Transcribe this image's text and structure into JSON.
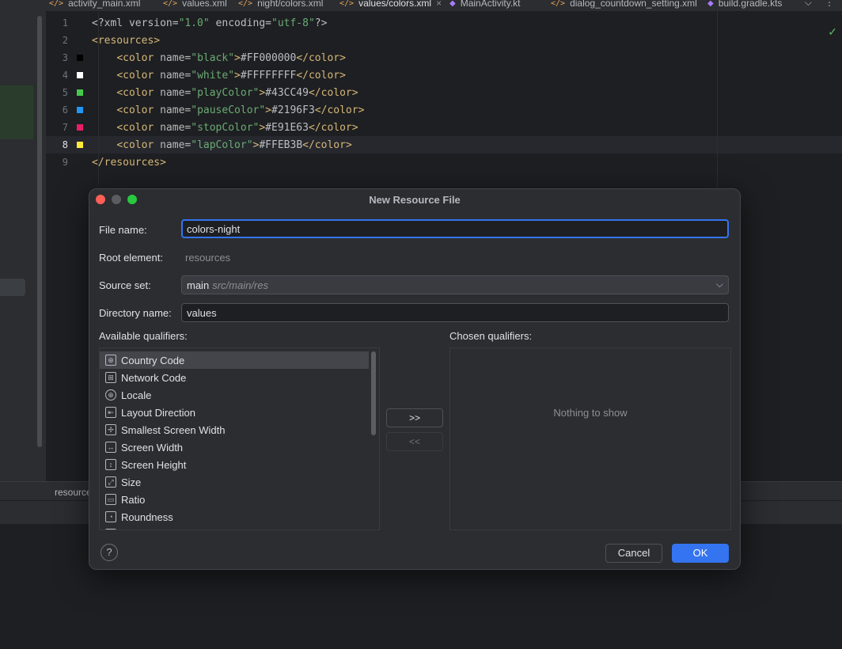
{
  "tabs": [
    {
      "label": "activity_main.xml",
      "icon": "xml-icon"
    },
    {
      "label": "values.xml",
      "icon": "xml-icon"
    },
    {
      "label": "night/colors.xml",
      "icon": "xml-icon"
    },
    {
      "label": "values/colors.xml",
      "icon": "xml-icon",
      "close": "×"
    },
    {
      "label": "MainActivity.kt",
      "icon": "kotlin-icon"
    },
    {
      "label": "dialog_countdown_setting.xml",
      "icon": "xml-icon"
    },
    {
      "label": "build.gradle.kts",
      "icon": "gradle-icon"
    }
  ],
  "tab_overflow": "⌵",
  "tab_more": "⋮",
  "editor": {
    "lines": [
      {
        "num": "1",
        "swatch": "",
        "parts": [
          {
            "t": "text",
            "v": "<?xml version="
          },
          {
            "t": "str",
            "v": "\"1.0\""
          },
          {
            "t": "text",
            "v": " encoding="
          },
          {
            "t": "str",
            "v": "\"utf-8\""
          },
          {
            "t": "text",
            "v": "?>"
          }
        ]
      },
      {
        "num": "2",
        "swatch": "",
        "parts": [
          {
            "t": "tag",
            "v": "<resources>"
          }
        ]
      },
      {
        "num": "3",
        "swatch": "#000000",
        "parts": [
          {
            "t": "text",
            "v": "    "
          },
          {
            "t": "tag",
            "v": "<color "
          },
          {
            "t": "attr",
            "v": "name="
          },
          {
            "t": "str",
            "v": "\"black\""
          },
          {
            "t": "tag",
            "v": ">"
          },
          {
            "t": "text",
            "v": "#FF000000"
          },
          {
            "t": "tag",
            "v": "</color>"
          }
        ]
      },
      {
        "num": "4",
        "swatch": "#FFFFFF",
        "parts": [
          {
            "t": "text",
            "v": "    "
          },
          {
            "t": "tag",
            "v": "<color "
          },
          {
            "t": "attr",
            "v": "name="
          },
          {
            "t": "str",
            "v": "\"white\""
          },
          {
            "t": "tag",
            "v": ">"
          },
          {
            "t": "text",
            "v": "#FFFFFFFF"
          },
          {
            "t": "tag",
            "v": "</color>"
          }
        ]
      },
      {
        "num": "5",
        "swatch": "#43CC49",
        "parts": [
          {
            "t": "text",
            "v": "    "
          },
          {
            "t": "tag",
            "v": "<color "
          },
          {
            "t": "attr",
            "v": "name="
          },
          {
            "t": "str",
            "v": "\"playColor\""
          },
          {
            "t": "tag",
            "v": ">"
          },
          {
            "t": "text",
            "v": "#43CC49"
          },
          {
            "t": "tag",
            "v": "</color>"
          }
        ]
      },
      {
        "num": "6",
        "swatch": "#2196F3",
        "parts": [
          {
            "t": "text",
            "v": "    "
          },
          {
            "t": "tag",
            "v": "<color "
          },
          {
            "t": "attr",
            "v": "name="
          },
          {
            "t": "str",
            "v": "\"pauseColor\""
          },
          {
            "t": "tag",
            "v": ">"
          },
          {
            "t": "text",
            "v": "#2196F3"
          },
          {
            "t": "tag",
            "v": "</color>"
          }
        ]
      },
      {
        "num": "7",
        "swatch": "#E91E63",
        "parts": [
          {
            "t": "text",
            "v": "    "
          },
          {
            "t": "tag",
            "v": "<color "
          },
          {
            "t": "attr",
            "v": "name="
          },
          {
            "t": "str",
            "v": "\"stopColor\""
          },
          {
            "t": "tag",
            "v": ">"
          },
          {
            "t": "text",
            "v": "#E91E63"
          },
          {
            "t": "tag",
            "v": "</color>"
          }
        ]
      },
      {
        "num": "8",
        "swatch": "#FFEB3B",
        "current": true,
        "parts": [
          {
            "t": "text",
            "v": "    "
          },
          {
            "t": "tag",
            "v": "<color "
          },
          {
            "t": "attr",
            "v": "name="
          },
          {
            "t": "str",
            "v": "\"lapColor\""
          },
          {
            "t": "tag",
            "v": ">"
          },
          {
            "t": "text",
            "v": "#FFEB3B"
          },
          {
            "t": "tag",
            "v": "</color>"
          }
        ]
      },
      {
        "num": "9",
        "swatch": "",
        "parts": [
          {
            "t": "tag",
            "v": "</resources>"
          }
        ]
      }
    ]
  },
  "bottom_tab": "resources",
  "dialog": {
    "title": "New Resource File",
    "file_name_label": "File name:",
    "file_name_value": "colors-night",
    "root_element_label": "Root element:",
    "root_element_value": "resources",
    "source_set_label": "Source set:",
    "source_set_main": "main",
    "source_set_path": "src/main/res",
    "directory_label": "Directory name:",
    "directory_value": "values",
    "available_label": "Available qualifiers:",
    "chosen_label": "Chosen qualifiers:",
    "qualifiers": [
      {
        "label": "Country Code",
        "icon": "country-code-icon",
        "glyph": "⊕",
        "selected": true
      },
      {
        "label": "Network Code",
        "icon": "network-code-icon",
        "glyph": "⊞"
      },
      {
        "label": "Locale",
        "icon": "globe-icon",
        "glyph": "⊕",
        "round": true
      },
      {
        "label": "Layout Direction",
        "icon": "layout-direction-icon",
        "glyph": "⇤"
      },
      {
        "label": "Smallest Screen Width",
        "icon": "smallest-width-icon",
        "glyph": "✢"
      },
      {
        "label": "Screen Width",
        "icon": "screen-width-icon",
        "glyph": "↔"
      },
      {
        "label": "Screen Height",
        "icon": "screen-height-icon",
        "glyph": "↕"
      },
      {
        "label": "Size",
        "icon": "size-icon",
        "glyph": "⤢"
      },
      {
        "label": "Ratio",
        "icon": "ratio-icon",
        "glyph": "▭"
      },
      {
        "label": "Roundness",
        "icon": "roundness-icon",
        "glyph": "◔"
      }
    ],
    "add_button": ">>",
    "remove_button": "<<",
    "chosen_empty": "Nothing to show",
    "help": "?",
    "cancel": "Cancel",
    "ok": "OK"
  },
  "colors": {
    "accent": "#3574f0",
    "dialog_bg": "#2b2d30",
    "editor_bg": "#1e1f22"
  }
}
